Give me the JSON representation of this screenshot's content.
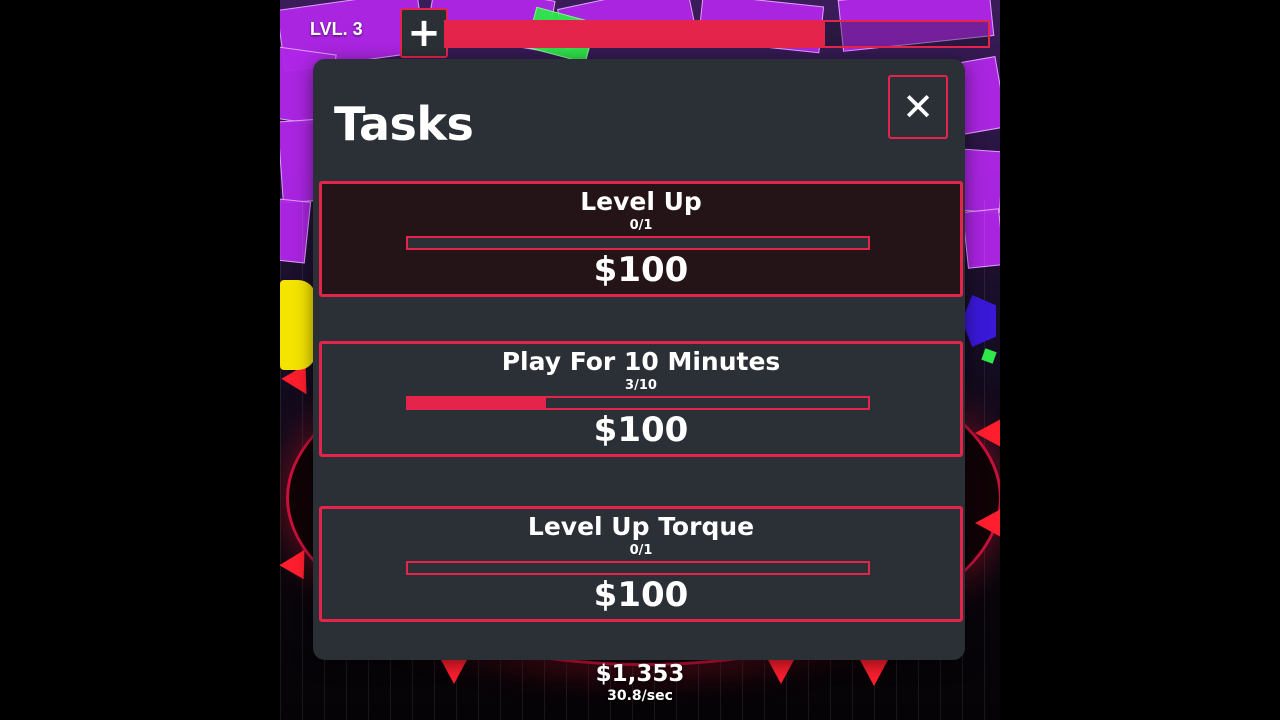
{
  "hud": {
    "level_label": "LVL. 3",
    "add_icon": "plus-icon",
    "xp_progress": 0.7
  },
  "tasks_panel": {
    "title": "Tasks",
    "close_icon": "close-icon",
    "close_glyph": "✕",
    "items": [
      {
        "name": "Level Up",
        "progress_text": "0/1",
        "progress": 0.0,
        "reward": "$100",
        "highlighted": true
      },
      {
        "name": "Play For 10 Minutes",
        "progress_text": "3/10",
        "progress": 0.3,
        "reward": "$100",
        "highlighted": false
      },
      {
        "name": "Level Up Torque",
        "progress_text": "0/1",
        "progress": 0.0,
        "reward": "$100",
        "highlighted": false
      }
    ]
  },
  "economy": {
    "balance": "$1,353",
    "rate": "30.8/sec"
  },
  "colors": {
    "accent": "#e5244c",
    "panel": "#2b2f36",
    "shard": "#b026e8"
  }
}
